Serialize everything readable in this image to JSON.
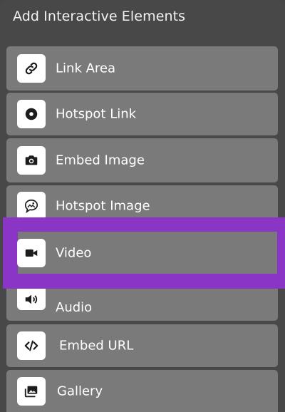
{
  "panel": {
    "title": "Add Interactive Elements"
  },
  "items": [
    {
      "label": "Link Area",
      "icon": "link-icon"
    },
    {
      "label": "Hotspot Link",
      "icon": "hotspot-dot-icon"
    },
    {
      "label": "Embed Image",
      "icon": "camera-icon"
    },
    {
      "label": "Hotspot Image",
      "icon": "image-bubble-icon"
    },
    {
      "label": "Video",
      "icon": "video-camera-icon"
    },
    {
      "label": "Audio",
      "icon": "speaker-icon"
    },
    {
      "label": "Embed URL",
      "icon": "code-icon"
    },
    {
      "label": "Gallery",
      "icon": "gallery-icon"
    }
  ],
  "colors": {
    "panel_bg": "#484848",
    "item_bg": "#7a7a7a",
    "highlight": "#8a35c5",
    "icon_tile": "#ffffff",
    "icon_glyph": "#1c1c1c"
  }
}
